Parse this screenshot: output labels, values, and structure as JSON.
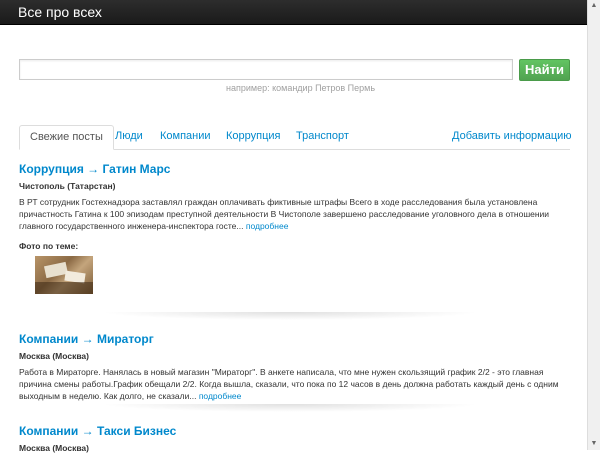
{
  "header": {
    "brand": "Все про всех"
  },
  "search": {
    "value": "",
    "button_label": "Найти",
    "hint": "например: командир Петров Пермь"
  },
  "tabs": [
    {
      "label": "Свежие посты",
      "active": true
    },
    {
      "label": "Люди"
    },
    {
      "label": "Компании"
    },
    {
      "label": "Коррупция"
    },
    {
      "label": "Транспорт"
    },
    {
      "label": "Добавить информацию"
    }
  ],
  "posts": [
    {
      "title": "Коррупция → Гатин Марс",
      "location": "Чистополь (Татарстан)",
      "text": "В РТ сотрудник Гостехнадзора заставлял граждан оплачивать фиктивные штрафы Всего в ходе расследования была установлена причастность Гатина к 100 эпизодам преступной деятельности В Чистополе завершено расследование уголовного дела в отношении главного государственного инженера-инспектора госте...",
      "more": "подробнее",
      "photos_label": "Фото по теме:"
    },
    {
      "title": "Компании → Мираторг",
      "location": "Москва (Москва)",
      "text": "Работа в Мираторге. Нанялась в новый магазин \"Мираторг\". В анкете написала, что мне нужен скользящий график 2/2 - это главная причина смены работы.График обещали 2/2. Когда вышла, сказали, что пока по 12 часов в день должна работать каждый день с одним выходным в неделю. Как долго, не сказали...",
      "more": "подробнее"
    },
    {
      "title": "Компании → Такси Бизнес",
      "location": "Москва (Москва)"
    }
  ],
  "colors": {
    "link": "#0088cc",
    "button": "#5bb75b",
    "topbar": "#222222"
  }
}
